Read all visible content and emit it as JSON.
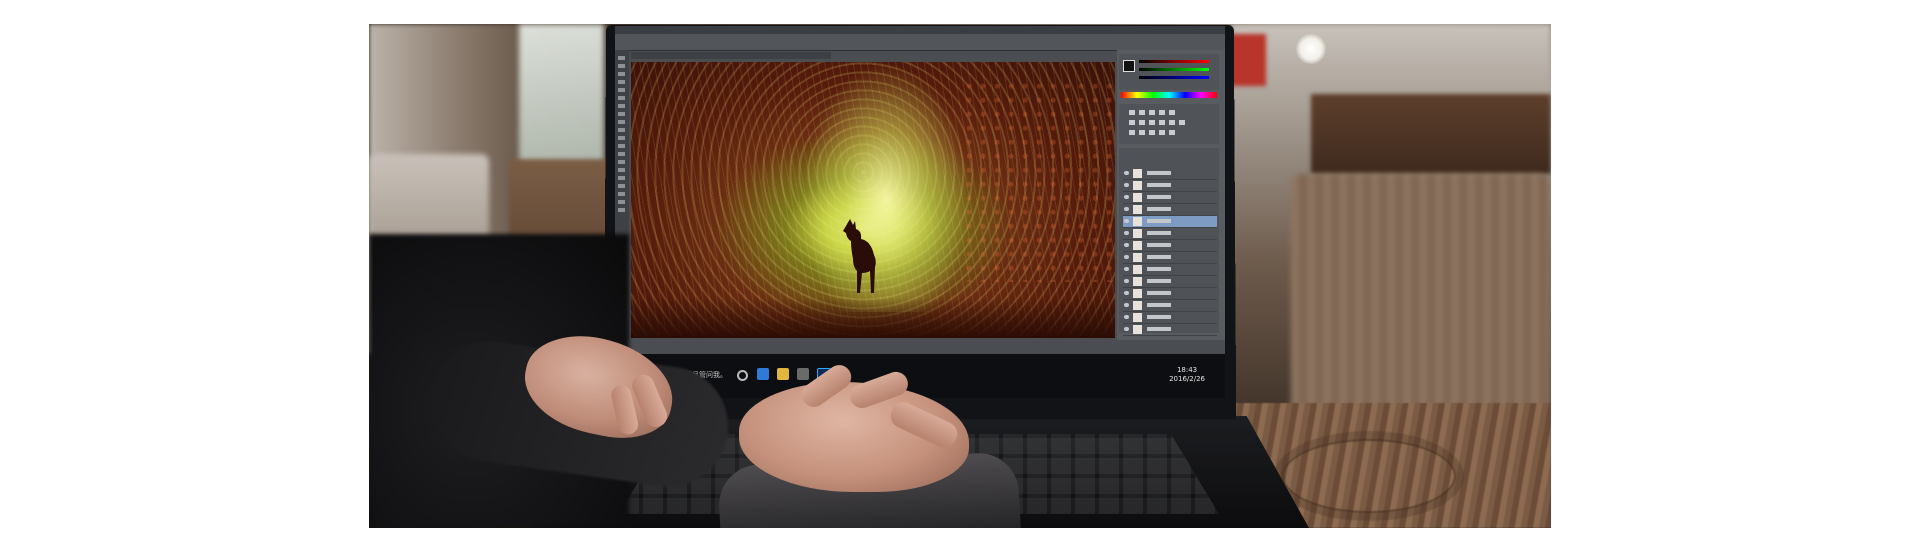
{
  "scene": {
    "screen": {
      "app": "photoshop",
      "taskbar": {
        "search_text": "有问题尽管问我。",
        "clock_time": "18:43",
        "clock_date": "2016/2/26"
      },
      "layer_count": 14,
      "active_layer_index": 4
    },
    "colors": {
      "canvas_glow": "#e8ee7a",
      "canvas_dark": "#4a1509",
      "panel_gray": "#585b60",
      "taskbar": "#0d0e11",
      "active_layer": "#7e9bc4"
    }
  }
}
